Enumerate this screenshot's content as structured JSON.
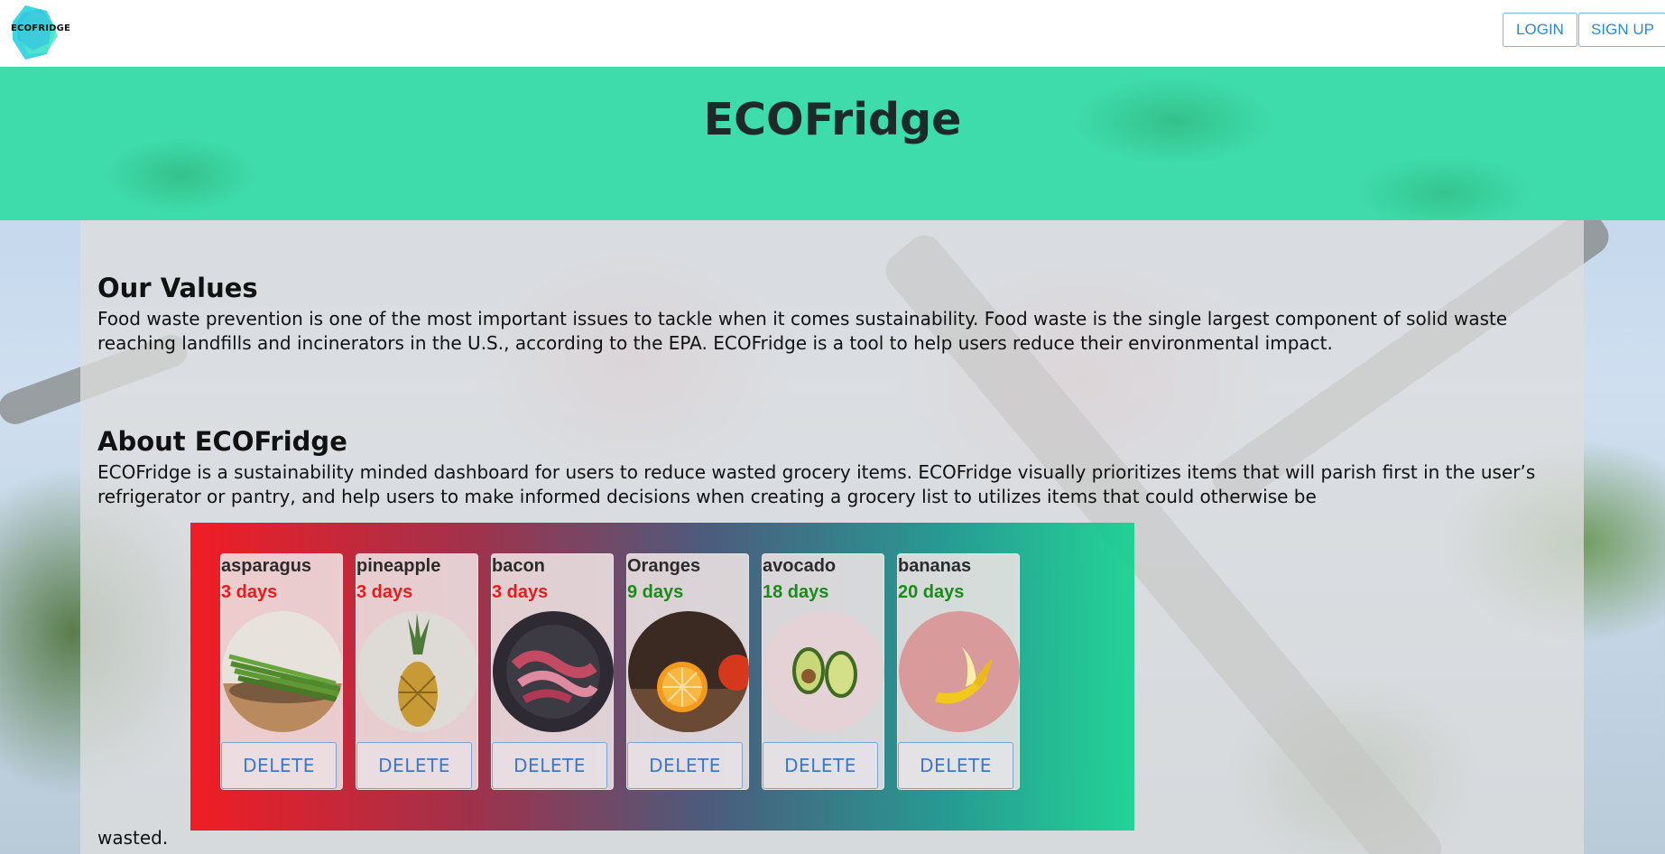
{
  "navbar": {
    "logo_text": "ECOFRIDGE",
    "login_label": "LOGIN",
    "signup_label": "SIGN UP"
  },
  "hero": {
    "title": "ECOFridge"
  },
  "values": {
    "title": "Our Values",
    "body": "Food waste prevention is one of the most important issues to tackle when it comes sustainability.  Food waste is the single largest component of solid waste reaching landfills and incinerators in the U.S., according to the EPA. ECOFridge is a tool to help users reduce their environmental impact."
  },
  "about": {
    "title": "About ECOFridge",
    "body": "ECOFridge is a sustainability minded dashboard for users to reduce wasted grocery items. ECOFridge visually prioritizes items that will parish first in the user’s refrigerator or pantry, and help users to make informed decisions when creating a grocery list to utilizes items that could otherwise be",
    "tail": "wasted."
  },
  "items": [
    {
      "name": "asparagus",
      "days": "3 days",
      "status": "red",
      "icon": "asparagus-image",
      "delete_label": "DELETE"
    },
    {
      "name": "pineapple",
      "days": "3 days",
      "status": "red",
      "icon": "pineapple-image",
      "delete_label": "DELETE"
    },
    {
      "name": "bacon",
      "days": "3 days",
      "status": "red",
      "icon": "bacon-image",
      "delete_label": "DELETE"
    },
    {
      "name": "Oranges",
      "days": "9 days",
      "status": "green",
      "icon": "oranges-image",
      "delete_label": "DELETE"
    },
    {
      "name": "avocado",
      "days": "18 days",
      "status": "green",
      "icon": "avocado-image",
      "delete_label": "DELETE"
    },
    {
      "name": "bananas",
      "days": "20 days",
      "status": "green",
      "icon": "bananas-image",
      "delete_label": "DELETE"
    }
  ],
  "colors": {
    "hero": "#3edcab",
    "expiring": "#e51c1c",
    "fresh": "#1b8a1b",
    "button_text": "#2a8bd3"
  }
}
